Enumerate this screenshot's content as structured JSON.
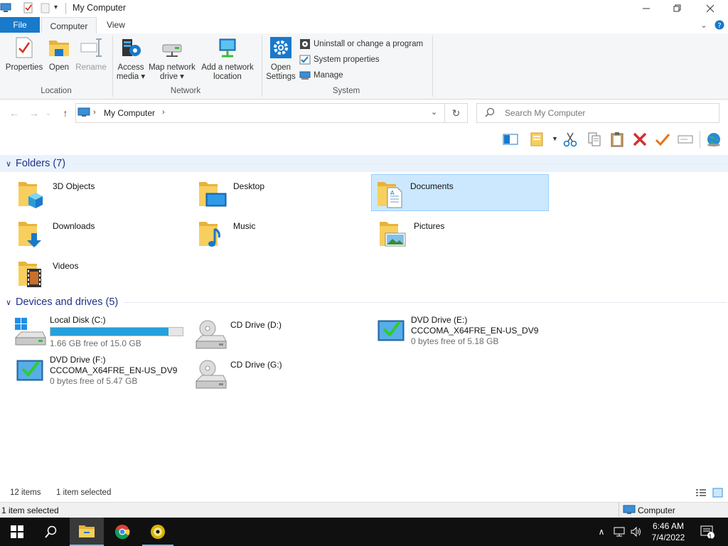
{
  "window": {
    "title": "My Computer"
  },
  "tabs": {
    "file": "File",
    "computer": "Computer",
    "view": "View"
  },
  "ribbon": {
    "location": {
      "label": "Location",
      "properties": "Properties",
      "open": "Open",
      "rename": "Rename"
    },
    "network": {
      "label": "Network",
      "access_media_1": "Access",
      "access_media_2": "media",
      "map_drive_1": "Map network",
      "map_drive_2": "drive",
      "add_location_1": "Add a network",
      "add_location_2": "location"
    },
    "system": {
      "label": "System",
      "open_settings_1": "Open",
      "open_settings_2": "Settings",
      "uninstall": "Uninstall or change a program",
      "system_properties": "System properties",
      "manage": "Manage"
    }
  },
  "address": {
    "path": "My Computer",
    "search_placeholder": "Search My Computer"
  },
  "groups": {
    "folders": "Folders (7)",
    "devices": "Devices and drives (5)"
  },
  "folders": [
    {
      "name": "3D Objects",
      "icon": "3d-objects-folder-icon"
    },
    {
      "name": "Desktop",
      "icon": "desktop-folder-icon"
    },
    {
      "name": "Documents",
      "icon": "documents-folder-icon"
    },
    {
      "name": "Downloads",
      "icon": "downloads-folder-icon"
    },
    {
      "name": "Music",
      "icon": "music-folder-icon"
    },
    {
      "name": "Pictures",
      "icon": "pictures-folder-icon"
    },
    {
      "name": "Videos",
      "icon": "videos-folder-icon"
    }
  ],
  "drives": [
    {
      "name": "Local Disk (C:)",
      "free": "1.66 GB free of 15.0 GB",
      "used_fraction": 0.89
    },
    {
      "name": "CD Drive (D:)"
    },
    {
      "name": "DVD Drive (E:)",
      "label": "CCCOMA_X64FRE_EN-US_DV9",
      "free": "0 bytes free of 5.18 GB"
    },
    {
      "name": "DVD Drive (F:)",
      "label": "CCCOMA_X64FRE_EN-US_DV9",
      "free": "0 bytes free of 5.47 GB"
    },
    {
      "name": "CD Drive (G:)"
    }
  ],
  "status": {
    "items": "12 items",
    "selected": "1 item selected"
  },
  "bottombar": {
    "selected": "1 item selected",
    "location": "Computer"
  },
  "taskbar": {
    "time": "6:46 AM",
    "date": "7/4/2022",
    "notifications": "1"
  },
  "colors": {
    "accent": "#1979ca",
    "selection": "#cce8ff",
    "group_header": "#1e3287",
    "disk_bar": "#26a0da"
  }
}
